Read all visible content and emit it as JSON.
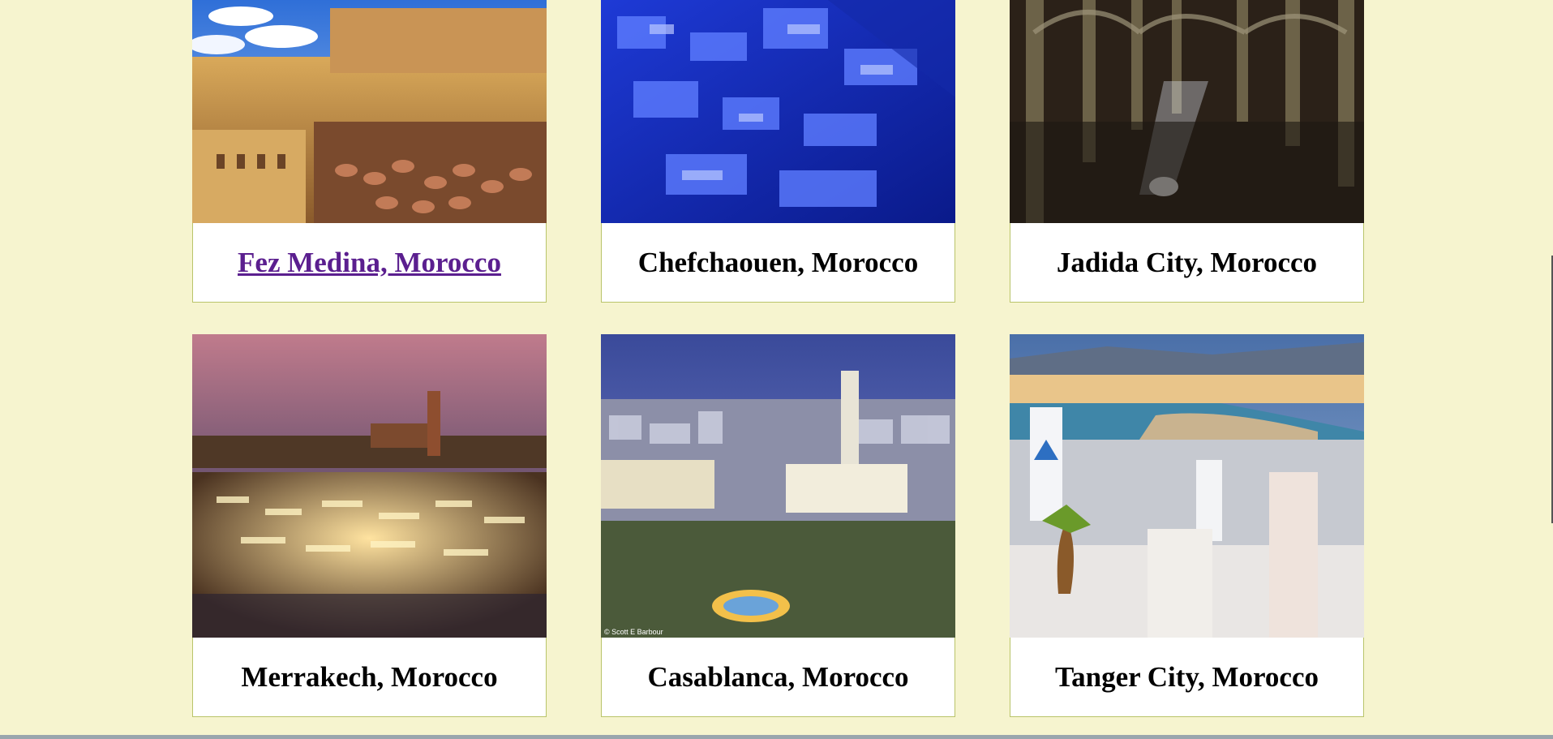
{
  "destinations": [
    {
      "title": "Fez Medina, Morocco",
      "image": "fez-medina-photo",
      "visited": true
    },
    {
      "title": "Chefchaouen, Morocco",
      "image": "chefchaouen-photo",
      "visited": false
    },
    {
      "title": "Jadida City, Morocco",
      "image": "jadida-cistern-photo",
      "visited": false
    },
    {
      "title": "Merrakech, Morocco",
      "image": "marrakech-square-photo",
      "visited": false
    },
    {
      "title": "Casablanca, Morocco",
      "image": "casablanca-photo",
      "visited": false
    },
    {
      "title": "Tanger City, Morocco",
      "image": "tanger-photo",
      "visited": false
    }
  ],
  "photo_credit": "© Scott E Barbour",
  "colors": {
    "background": "#f6f4cf",
    "caption_border": "#b9c46a",
    "visited_link": "#5b1f8f"
  }
}
